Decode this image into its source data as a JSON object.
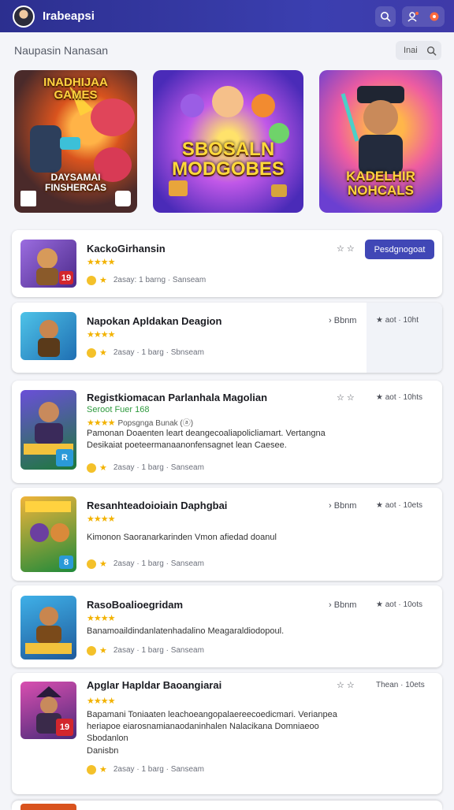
{
  "header": {
    "title": "Irabeapsi",
    "icons": [
      "avatar",
      "search-icon",
      "user-add-icon",
      "notification-icon"
    ],
    "accent": "#3b3fb0"
  },
  "section": {
    "title": "Naupasin Nanasan",
    "search_text": "Inai"
  },
  "banners": [
    {
      "title_top": "INADHIJAA\nGAMES",
      "title_bottom": "DAYSAMAI\nFINSHERCAS"
    },
    {
      "title": "SBOSALN\nMODGOBES"
    },
    {
      "title": "KADELHIR\nNOHCALS"
    }
  ],
  "cards": [
    {
      "title": "KackoGirhansin",
      "rating": "★★★★",
      "meta_text": "2asay: 1 barng · Sanseam",
      "right_stars": "☆ ☆",
      "button": "Pesdgnogoat",
      "badge": "19"
    },
    {
      "title": "Napokan Apldakan Deagion",
      "rating": "★★★★",
      "meta_text": "2asay · 1 barg · Sbnseam",
      "right_a": "Bbnm",
      "right_b": "★ aot · 10ht"
    },
    {
      "title": "Registkiomacan Parlanhala Magolian",
      "subtitle": "Seroot Fuer 168",
      "rating": "★★★★",
      "rating_extra": "Popsgnga  Bunak (ⓐ)",
      "description": "Pamonan Doaenten leart deangecoaliapolicliamart. Vertangna Desikaiat poeteermanaanonfensagnet lean Caesee.",
      "meta_text": "2asay · 1 barg · Sanseam",
      "right_stars": "☆ ☆",
      "right_b": "★ aot · 10hts",
      "badge": "R"
    },
    {
      "title": "Resanhteadoioiain Daphgbai",
      "rating": "★★★★",
      "description": "Kimonon Saoranarkarinden Vmon afiedad doanul",
      "meta_text": "2asay · 1 barg · Sanseam",
      "right_a": "Bbnm",
      "right_b": "★ aot · 10ets",
      "badge": "8"
    },
    {
      "title": "RasoBoalioegridam",
      "rating": "★★★★",
      "description": "Banamoaildindanlatenhadalino Meagaraldiodopoul.",
      "meta_text": "2asay · 1 barg · Sanseam",
      "right_a": "Bbnm",
      "right_b": "★ aot · 10ots"
    },
    {
      "title": "Apglar Hapldar Baoangiarai",
      "rating": "★★★★",
      "description": "Bapamani Toniaaten leachoeangopalaereecoedicmari. Verianpea heriapoe eiarosnamianaodaninhalen Nalacikana Domniaeoo Sbodanlon",
      "extra_line": "Danisbn",
      "meta_text": "2asay · 1 barg · Sanseam",
      "right_stars": "☆ ☆",
      "right_b": "Thean · 10ets",
      "badge": "19"
    }
  ]
}
